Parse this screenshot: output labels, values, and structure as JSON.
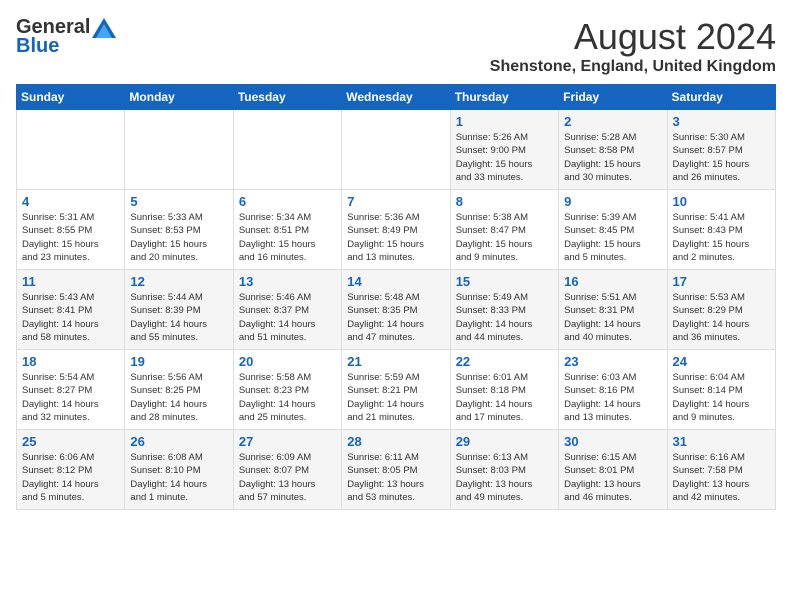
{
  "header": {
    "logo_general": "General",
    "logo_blue": "Blue",
    "month_title": "August 2024",
    "location": "Shenstone, England, United Kingdom"
  },
  "weekdays": [
    "Sunday",
    "Monday",
    "Tuesday",
    "Wednesday",
    "Thursday",
    "Friday",
    "Saturday"
  ],
  "weeks": [
    [
      {
        "day": "",
        "info": ""
      },
      {
        "day": "",
        "info": ""
      },
      {
        "day": "",
        "info": ""
      },
      {
        "day": "",
        "info": ""
      },
      {
        "day": "1",
        "info": "Sunrise: 5:26 AM\nSunset: 9:00 PM\nDaylight: 15 hours\nand 33 minutes."
      },
      {
        "day": "2",
        "info": "Sunrise: 5:28 AM\nSunset: 8:58 PM\nDaylight: 15 hours\nand 30 minutes."
      },
      {
        "day": "3",
        "info": "Sunrise: 5:30 AM\nSunset: 8:57 PM\nDaylight: 15 hours\nand 26 minutes."
      }
    ],
    [
      {
        "day": "4",
        "info": "Sunrise: 5:31 AM\nSunset: 8:55 PM\nDaylight: 15 hours\nand 23 minutes."
      },
      {
        "day": "5",
        "info": "Sunrise: 5:33 AM\nSunset: 8:53 PM\nDaylight: 15 hours\nand 20 minutes."
      },
      {
        "day": "6",
        "info": "Sunrise: 5:34 AM\nSunset: 8:51 PM\nDaylight: 15 hours\nand 16 minutes."
      },
      {
        "day": "7",
        "info": "Sunrise: 5:36 AM\nSunset: 8:49 PM\nDaylight: 15 hours\nand 13 minutes."
      },
      {
        "day": "8",
        "info": "Sunrise: 5:38 AM\nSunset: 8:47 PM\nDaylight: 15 hours\nand 9 minutes."
      },
      {
        "day": "9",
        "info": "Sunrise: 5:39 AM\nSunset: 8:45 PM\nDaylight: 15 hours\nand 5 minutes."
      },
      {
        "day": "10",
        "info": "Sunrise: 5:41 AM\nSunset: 8:43 PM\nDaylight: 15 hours\nand 2 minutes."
      }
    ],
    [
      {
        "day": "11",
        "info": "Sunrise: 5:43 AM\nSunset: 8:41 PM\nDaylight: 14 hours\nand 58 minutes."
      },
      {
        "day": "12",
        "info": "Sunrise: 5:44 AM\nSunset: 8:39 PM\nDaylight: 14 hours\nand 55 minutes."
      },
      {
        "day": "13",
        "info": "Sunrise: 5:46 AM\nSunset: 8:37 PM\nDaylight: 14 hours\nand 51 minutes."
      },
      {
        "day": "14",
        "info": "Sunrise: 5:48 AM\nSunset: 8:35 PM\nDaylight: 14 hours\nand 47 minutes."
      },
      {
        "day": "15",
        "info": "Sunrise: 5:49 AM\nSunset: 8:33 PM\nDaylight: 14 hours\nand 44 minutes."
      },
      {
        "day": "16",
        "info": "Sunrise: 5:51 AM\nSunset: 8:31 PM\nDaylight: 14 hours\nand 40 minutes."
      },
      {
        "day": "17",
        "info": "Sunrise: 5:53 AM\nSunset: 8:29 PM\nDaylight: 14 hours\nand 36 minutes."
      }
    ],
    [
      {
        "day": "18",
        "info": "Sunrise: 5:54 AM\nSunset: 8:27 PM\nDaylight: 14 hours\nand 32 minutes."
      },
      {
        "day": "19",
        "info": "Sunrise: 5:56 AM\nSunset: 8:25 PM\nDaylight: 14 hours\nand 28 minutes."
      },
      {
        "day": "20",
        "info": "Sunrise: 5:58 AM\nSunset: 8:23 PM\nDaylight: 14 hours\nand 25 minutes."
      },
      {
        "day": "21",
        "info": "Sunrise: 5:59 AM\nSunset: 8:21 PM\nDaylight: 14 hours\nand 21 minutes."
      },
      {
        "day": "22",
        "info": "Sunrise: 6:01 AM\nSunset: 8:18 PM\nDaylight: 14 hours\nand 17 minutes."
      },
      {
        "day": "23",
        "info": "Sunrise: 6:03 AM\nSunset: 8:16 PM\nDaylight: 14 hours\nand 13 minutes."
      },
      {
        "day": "24",
        "info": "Sunrise: 6:04 AM\nSunset: 8:14 PM\nDaylight: 14 hours\nand 9 minutes."
      }
    ],
    [
      {
        "day": "25",
        "info": "Sunrise: 6:06 AM\nSunset: 8:12 PM\nDaylight: 14 hours\nand 5 minutes."
      },
      {
        "day": "26",
        "info": "Sunrise: 6:08 AM\nSunset: 8:10 PM\nDaylight: 14 hours\nand 1 minute."
      },
      {
        "day": "27",
        "info": "Sunrise: 6:09 AM\nSunset: 8:07 PM\nDaylight: 13 hours\nand 57 minutes."
      },
      {
        "day": "28",
        "info": "Sunrise: 6:11 AM\nSunset: 8:05 PM\nDaylight: 13 hours\nand 53 minutes."
      },
      {
        "day": "29",
        "info": "Sunrise: 6:13 AM\nSunset: 8:03 PM\nDaylight: 13 hours\nand 49 minutes."
      },
      {
        "day": "30",
        "info": "Sunrise: 6:15 AM\nSunset: 8:01 PM\nDaylight: 13 hours\nand 46 minutes."
      },
      {
        "day": "31",
        "info": "Sunrise: 6:16 AM\nSunset: 7:58 PM\nDaylight: 13 hours\nand 42 minutes."
      }
    ]
  ]
}
